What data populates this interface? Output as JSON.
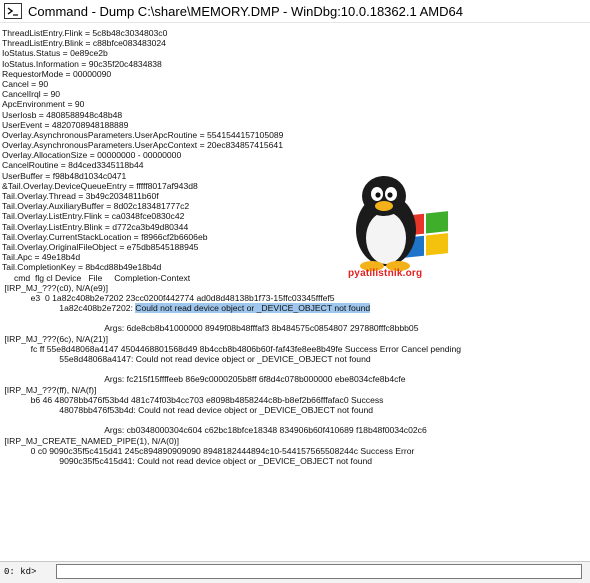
{
  "window": {
    "title": "Command - Dump C:\\share\\MEMORY.DMP - WinDbg:10.0.18362.1 AMD64"
  },
  "output_lines": [
    "ThreadListEntry.Flink = 5c8b48c3034803c0",
    "ThreadListEntry.Blink = c88bfce083483024",
    "IoStatus.Status = 0e89ce2b",
    "IoStatus.Information = 90c35f20c4834838",
    "RequestorMode = 00000090",
    "Cancel = 90",
    "CancelIrql = 90",
    "ApcEnvironment = 90",
    "UserIosb = 4808588948c48b48",
    "UserEvent = 4820708948188889",
    "Overlay.AsynchronousParameters.UserApcRoutine = 5541544157105089",
    "Overlay.AsynchronousParameters.UserApcContext = 20ec834857415641",
    "Overlay.AllocationSize = 00000000 - 00000000",
    "CancelRoutine = 8d4ced3345118b44",
    "UserBuffer = f98b48d1034c0471",
    "&Tail.Overlay.DeviceQueueEntry = fffff8017af943d8",
    "Tail.Overlay.Thread = 3b49c2034811b60f",
    "Tail.Overlay.AuxiliaryBuffer = 8d02c183481777c2",
    "Tail.Overlay.ListEntry.Flink = ca0348fce0830c42",
    "Tail.Overlay.ListEntry.Blink = d772ca3b49d80344",
    "Tail.Overlay.CurrentStackLocation = f8966cf2b6606eb",
    "Tail.Overlay.OriginalFileObject = e75db8545188945",
    "Tail.Apc = 49e18b4d",
    "Tail.CompletionKey = 8b4cd88b49e18b4d",
    "     cmd  flg cl Device   File     Completion-Context",
    " [IRP_MJ_???(c0), N/A(e9)]",
    "            e3  0 1a82c408b2e7202 23cc0200f442774 ad0d8d48138b1f73-15ffc03345fffef5",
    "                        1a82c408b2e7202: Could not read device object or _DEVICE_OBJECT not found",
    "",
    "                                           Args: 6de8cb8b41000000 8949f08b48fffaf3 8b484575c0854807 297880fffc8bbb05",
    " [IRP_MJ_???(6c), N/A(21)]",
    "            fc ff 55e8d48068a4147 4504468801568d49 8b4ccb8b4806b60f-faf43fe8ee8b49fe Success Error Cancel pending",
    "                        55e8d48068a4147: Could not read device object or _DEVICE_OBJECT not found",
    "",
    "                                           Args: fc215f15ffffeeb 86e9c0000205b8ff 6f8d4c078b000000 ebe8034cfe8b4cfe",
    " [IRP_MJ_???(ff), N/A(f)]",
    "            b6 46 48078bb476f53b4d 481c74f03b4cc703 e8098b4858244c8b-b8ef2b66fffafac0 Success",
    "                        48078bb476f53b4d: Could not read device object or _DEVICE_OBJECT not found",
    "",
    "                                           Args: cb0348000304c604 c62bc18bfce18348 834906b60f410689 f18b48f0034c02c6",
    " [IRP_MJ_CREATE_NAMED_PIPE(1), N/A(0)]",
    "            0 c0 9090c35f5c415d41 245c894890909090 8948182444894c10-544157565508244c Success Error",
    "                        9090c35f5c415d41: Could not read device object or _DEVICE_OBJECT not found"
  ],
  "highlight": {
    "line_index": 27,
    "text": "Could not read device object or _DEVICE_OBJECT not found"
  },
  "logo": {
    "text": "pyatilistnik.org",
    "icon": "penguin-windows-logo"
  },
  "command": {
    "prompt": "0: kd>",
    "value": ""
  },
  "icons": {
    "title": "console-icon"
  }
}
